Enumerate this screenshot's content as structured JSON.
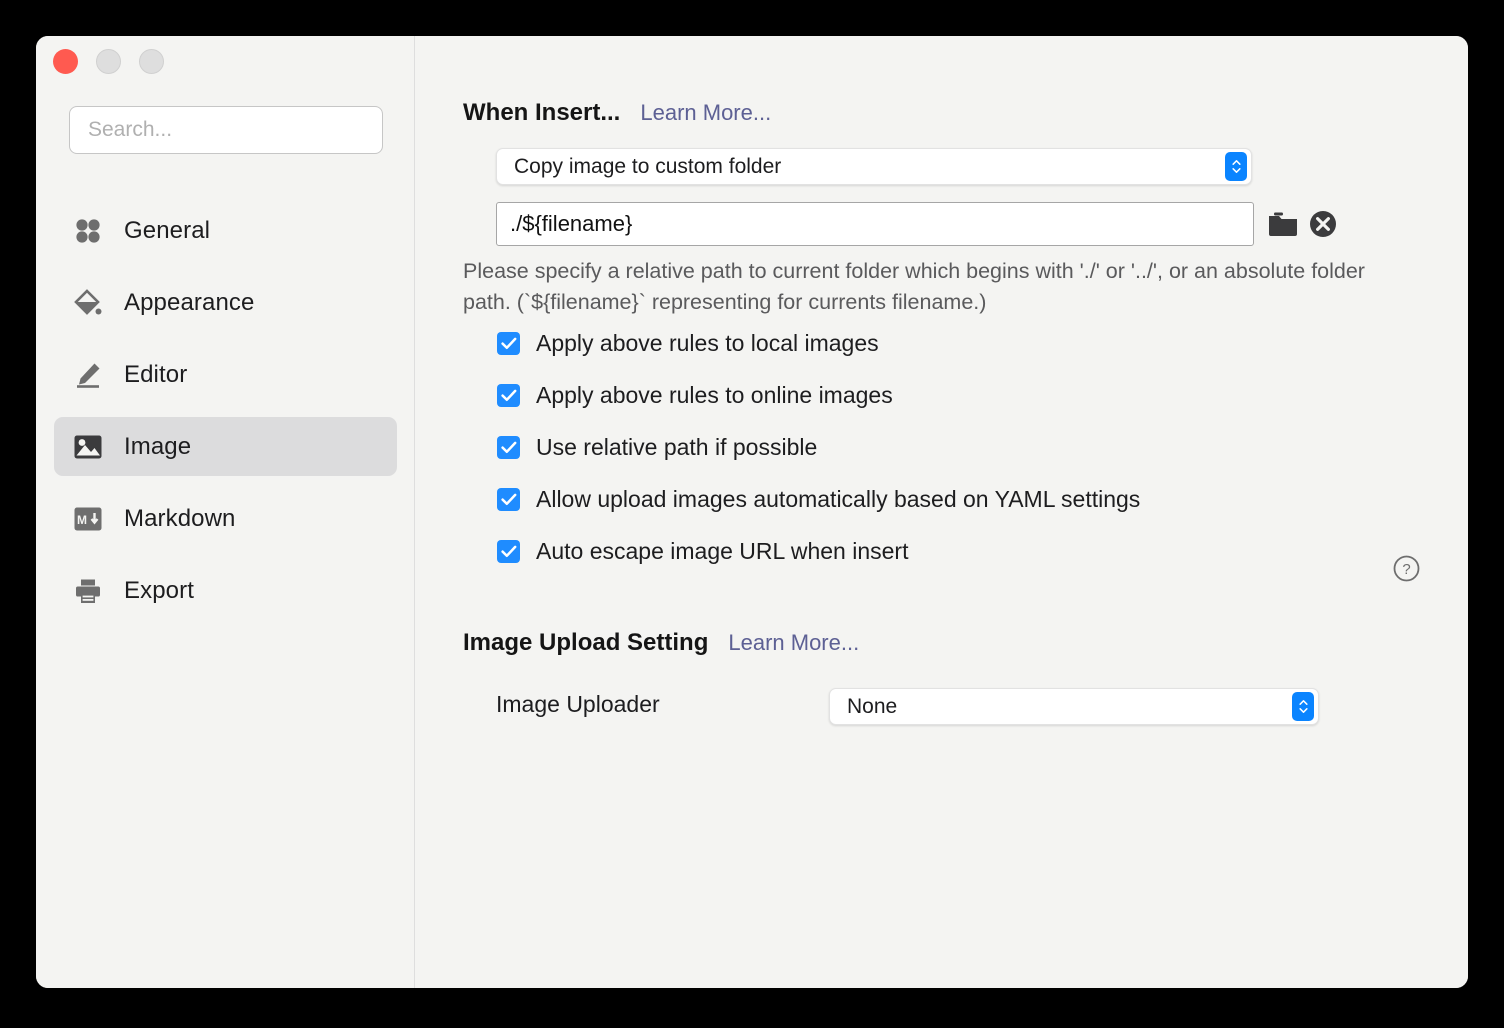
{
  "window": {
    "traffic_lights": [
      "close",
      "minimize",
      "zoom"
    ]
  },
  "sidebar": {
    "search": {
      "placeholder": "Search...",
      "value": ""
    },
    "items": [
      {
        "label": "General",
        "icon": "grid-dots-icon",
        "selected": false
      },
      {
        "label": "Appearance",
        "icon": "paint-bucket-icon",
        "selected": false
      },
      {
        "label": "Editor",
        "icon": "pencil-icon",
        "selected": false
      },
      {
        "label": "Image",
        "icon": "image-icon",
        "selected": true
      },
      {
        "label": "Markdown",
        "icon": "markdown-icon",
        "selected": false
      },
      {
        "label": "Export",
        "icon": "printer-icon",
        "selected": false
      }
    ]
  },
  "content": {
    "when_insert": {
      "title": "When Insert...",
      "learn_more": "Learn More...",
      "mode_select": {
        "value": "Copy image to custom folder"
      },
      "path_field": {
        "value": "./${filename}"
      },
      "browse_icon": "folder-icon",
      "clear_icon": "clear-circle-icon",
      "hint": " Please specify a relative path to current folder which begins with './' or '../', or an absolute folder path. (`${filename}` representing for currents filename.)",
      "checkboxes": [
        {
          "label": "Apply above rules to local images",
          "checked": true
        },
        {
          "label": "Apply above rules to online images",
          "checked": true
        },
        {
          "label": "Use relative path if possible",
          "checked": true
        },
        {
          "label": "Allow upload images automatically based on YAML settings",
          "checked": true
        },
        {
          "label": "Auto escape image URL when insert",
          "checked": true
        }
      ],
      "help_icon": "question-circle-icon"
    },
    "image_upload": {
      "title": "Image Upload Setting",
      "learn_more": "Learn More...",
      "uploader_label": "Image Uploader",
      "uploader_select": {
        "value": "None"
      }
    }
  },
  "colors": {
    "accent_blue": "#0a84ff",
    "checkbox_blue": "#1f8cff",
    "link": "#5d6094",
    "window_bg": "#f4f4f2",
    "selected_row": "#dcdcdd",
    "close_red": "#ff5a50"
  }
}
